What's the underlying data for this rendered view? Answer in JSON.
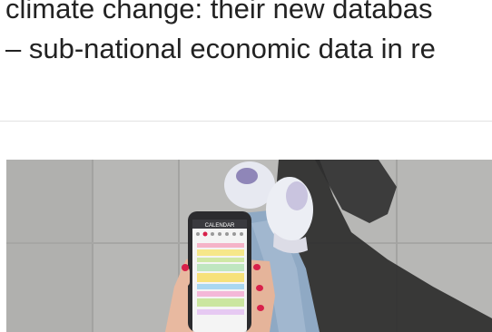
{
  "article": {
    "paragraph_lines": [
      "climate change: their new databas",
      "– sub-national economic data in re"
    ]
  },
  "image": {
    "icon": "photo-person-holding-phone-calendar-app",
    "phone_header_text": "CALENDAR"
  },
  "colors": {
    "text": "#222222",
    "divider": "#e3e3e3",
    "pavement": "#b4b4b2",
    "shadow": "#2a2a2a",
    "nail_polish": "#d8204a"
  }
}
